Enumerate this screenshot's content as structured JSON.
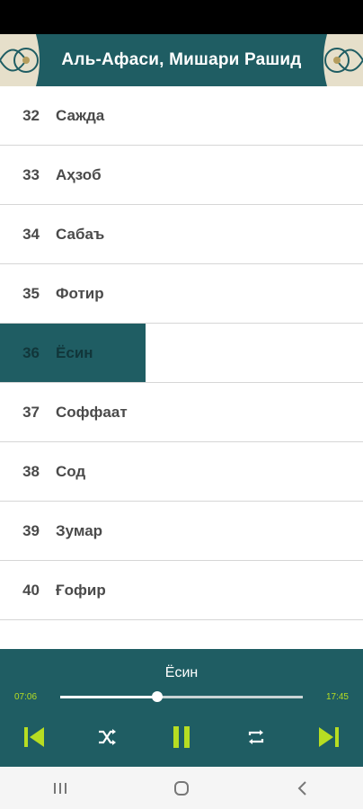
{
  "header": {
    "title": "Аль-Афаси, Мишари Рашид"
  },
  "list": {
    "items": [
      {
        "num": "32",
        "name": "Сажда"
      },
      {
        "num": "33",
        "name": "Аҳзоб"
      },
      {
        "num": "34",
        "name": "Сабаъ"
      },
      {
        "num": "35",
        "name": "Фотир"
      },
      {
        "num": "36",
        "name": "Ёсин"
      },
      {
        "num": "37",
        "name": "Соффаат"
      },
      {
        "num": "38",
        "name": "Сод"
      },
      {
        "num": "39",
        "name": "Зумар"
      },
      {
        "num": "40",
        "name": "Ғофир"
      }
    ],
    "active_num": "36"
  },
  "player": {
    "track": "Ёсин",
    "elapsed": "07:06",
    "total": "17:45",
    "progress": 0.4
  },
  "icons": {
    "prev": "skip-previous-icon",
    "shuffle": "shuffle-icon",
    "pause": "pause-icon",
    "repeat": "repeat-icon",
    "next": "skip-next-icon"
  },
  "colors": {
    "accent": "#1f5d63",
    "control": "#b7dd22"
  }
}
